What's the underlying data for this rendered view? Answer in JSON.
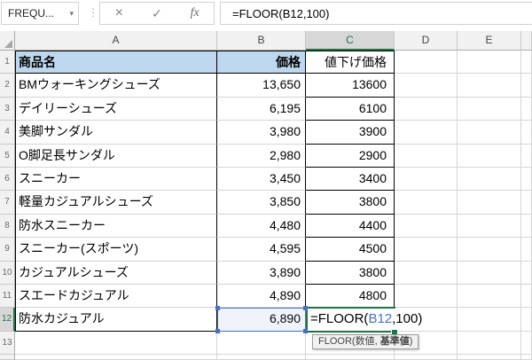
{
  "formula_bar": {
    "name_box": "FREQU...",
    "dropdown_icon": "▾",
    "separator_dots": "⋮",
    "cancel_label": "×",
    "enter_label": "✓",
    "fx_label": "fx",
    "formula": "=FLOOR(B12,100)"
  },
  "sheet": {
    "column_headers": [
      "A",
      "B",
      "C",
      "D",
      "E"
    ],
    "row_numbers": [
      "1",
      "2",
      "3",
      "4",
      "5",
      "6",
      "7",
      "8",
      "9",
      "10",
      "11",
      "12",
      "13"
    ],
    "selected_column": "C",
    "selected_row": "12",
    "table": {
      "header": {
        "name": "商品名",
        "price": "価格",
        "discount": "値下げ価格"
      },
      "products": [
        {
          "name": "BMウォーキングシューズ",
          "price": "13,650",
          "discount": "13600"
        },
        {
          "name": "デイリーシューズ",
          "price": "6,195",
          "discount": "6100"
        },
        {
          "name": "美脚サンダル",
          "price": "3,980",
          "discount": "3900"
        },
        {
          "name": "O脚足長サンダル",
          "price": "2,980",
          "discount": "2900"
        },
        {
          "name": "スニーカー",
          "price": "3,450",
          "discount": "3400"
        },
        {
          "name": "軽量カジュアルシューズ",
          "price": "3,850",
          "discount": "3800"
        },
        {
          "name": "防水スニーカー",
          "price": "4,480",
          "discount": "4400"
        },
        {
          "name": "スニーカー(スポーツ)",
          "price": "4,595",
          "discount": "4500"
        },
        {
          "name": "カジュアルシューズ",
          "price": "3,890",
          "discount": "3800"
        },
        {
          "name": "スエードカジュアル",
          "price": "4,890",
          "discount": "4800"
        },
        {
          "name": "防水カジュアル",
          "price": "6,890",
          "discount": null
        }
      ]
    },
    "editing": {
      "cell": "C12",
      "formula_prefix": "=FLOOR(",
      "formula_ref": "B12",
      "formula_suffix": ",100)",
      "referenced_cell": "B12"
    },
    "tooltip": {
      "prefix": "FLOOR(",
      "arg1": "数値",
      "separator": ", ",
      "arg2": "基準値",
      "suffix": ")"
    }
  },
  "colors": {
    "accent_green": "#217346",
    "reference_blue": "#4472C4",
    "table_header_fill": "#BDD7EE",
    "selected_header_bg": "#D7D7D7",
    "header_bg": "#F1F1F1",
    "grid_line": "#D4D4D4",
    "table_border": "#000000"
  }
}
